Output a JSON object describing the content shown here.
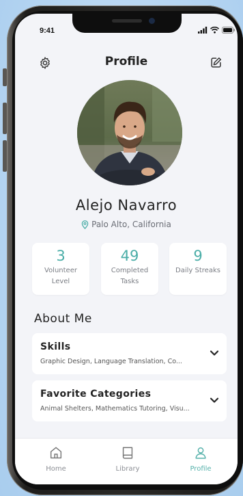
{
  "status_bar": {
    "time": "9:41"
  },
  "header": {
    "title": "Profile",
    "left_icon": "gear-icon",
    "right_icon": "edit-icon"
  },
  "profile": {
    "name": "Alejo Navarro",
    "location": "Palo Alto, California",
    "location_icon": "location-pin-icon"
  },
  "stats": [
    {
      "value": "3",
      "label": "Volunteer Level"
    },
    {
      "value": "49",
      "label": "Completed Tasks"
    },
    {
      "value": "9",
      "label": "Daily Streaks"
    }
  ],
  "about": {
    "title": "About Me",
    "sections": [
      {
        "title": "Skills",
        "summary": "Graphic Design, Language Translation, Co..."
      },
      {
        "title": "Favorite Categories",
        "summary": "Animal Shelters, Mathematics Tutoring, Visu..."
      }
    ]
  },
  "tabs": [
    {
      "label": "Home",
      "icon": "home-icon",
      "active": false
    },
    {
      "label": "Library",
      "icon": "book-icon",
      "active": false
    },
    {
      "label": "Profile",
      "icon": "user-icon",
      "active": true
    }
  ],
  "colors": {
    "accent": "#4aada7",
    "background": "#f3f4f8",
    "card": "#ffffff"
  }
}
